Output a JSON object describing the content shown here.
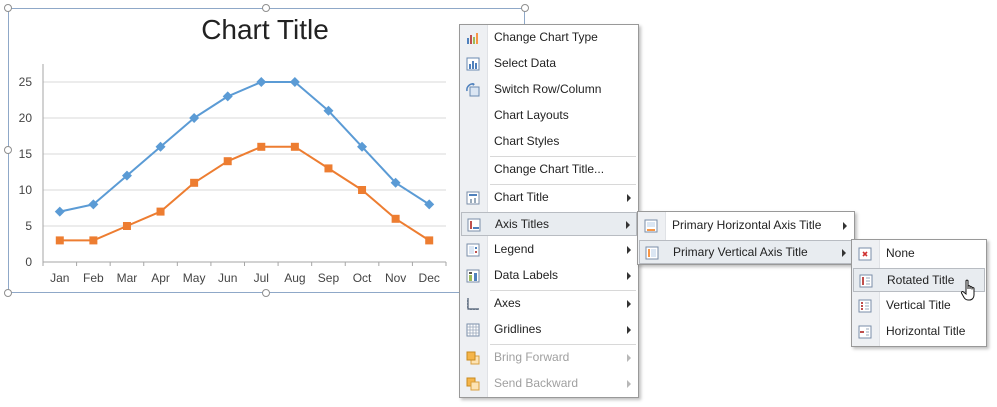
{
  "chart_data": {
    "type": "line",
    "title": "Chart Title",
    "categories": [
      "Jan",
      "Feb",
      "Mar",
      "Apr",
      "May",
      "Jun",
      "Jul",
      "Aug",
      "Sep",
      "Oct",
      "Nov",
      "Dec"
    ],
    "series": [
      {
        "values": [
          7,
          8,
          12,
          16,
          20,
          23,
          25,
          25,
          21,
          16,
          11,
          8
        ],
        "color": "#5b9bd5",
        "marker": "diamond"
      },
      {
        "values": [
          3,
          3,
          5,
          7,
          11,
          14,
          16,
          16,
          13,
          10,
          6,
          3
        ],
        "color": "#ed7d31",
        "marker": "square"
      }
    ],
    "y_ticks": [
      0,
      5,
      10,
      15,
      20,
      25
    ],
    "ylim": [
      0,
      25
    ],
    "grid": true,
    "legend": "none"
  },
  "context_menu": {
    "items": [
      {
        "label": "Change Chart Type",
        "icon": "chart-type-icon"
      },
      {
        "label": "Select Data",
        "icon": "select-data-icon"
      },
      {
        "label": "Switch Row/Column",
        "icon": "switch-row-column-icon"
      },
      {
        "label": "Chart Layouts",
        "icon": ""
      },
      {
        "label": "Chart Styles",
        "icon": ""
      },
      {
        "label": "Change Chart Title...",
        "icon": ""
      },
      {
        "label": "Chart Title",
        "icon": "chart-title-icon"
      },
      {
        "label": "Axis Titles",
        "icon": "axis-titles-icon"
      },
      {
        "label": "Legend",
        "icon": "legend-icon"
      },
      {
        "label": "Data Labels",
        "icon": "data-labels-icon"
      },
      {
        "label": "Axes",
        "icon": "axes-icon"
      },
      {
        "label": "Gridlines",
        "icon": "gridlines-icon"
      },
      {
        "label": "Bring Forward",
        "icon": "bring-forward-icon"
      },
      {
        "label": "Send Backward",
        "icon": "send-backward-icon"
      }
    ]
  },
  "axis_titles_menu": {
    "items": [
      {
        "label": "Primary Horizontal Axis Title",
        "icon": "horizontal-axis-title-icon"
      },
      {
        "label": "Primary Vertical Axis Title",
        "icon": "vertical-axis-title-icon"
      }
    ]
  },
  "vertical_title_menu": {
    "items": [
      {
        "label": "None",
        "icon": "none-icon"
      },
      {
        "label": "Rotated Title",
        "icon": "rotated-title-icon"
      },
      {
        "label": "Vertical Title",
        "icon": "vertical-title-icon"
      },
      {
        "label": "Horizontal Title",
        "icon": "horizontal-title-icon"
      }
    ]
  }
}
